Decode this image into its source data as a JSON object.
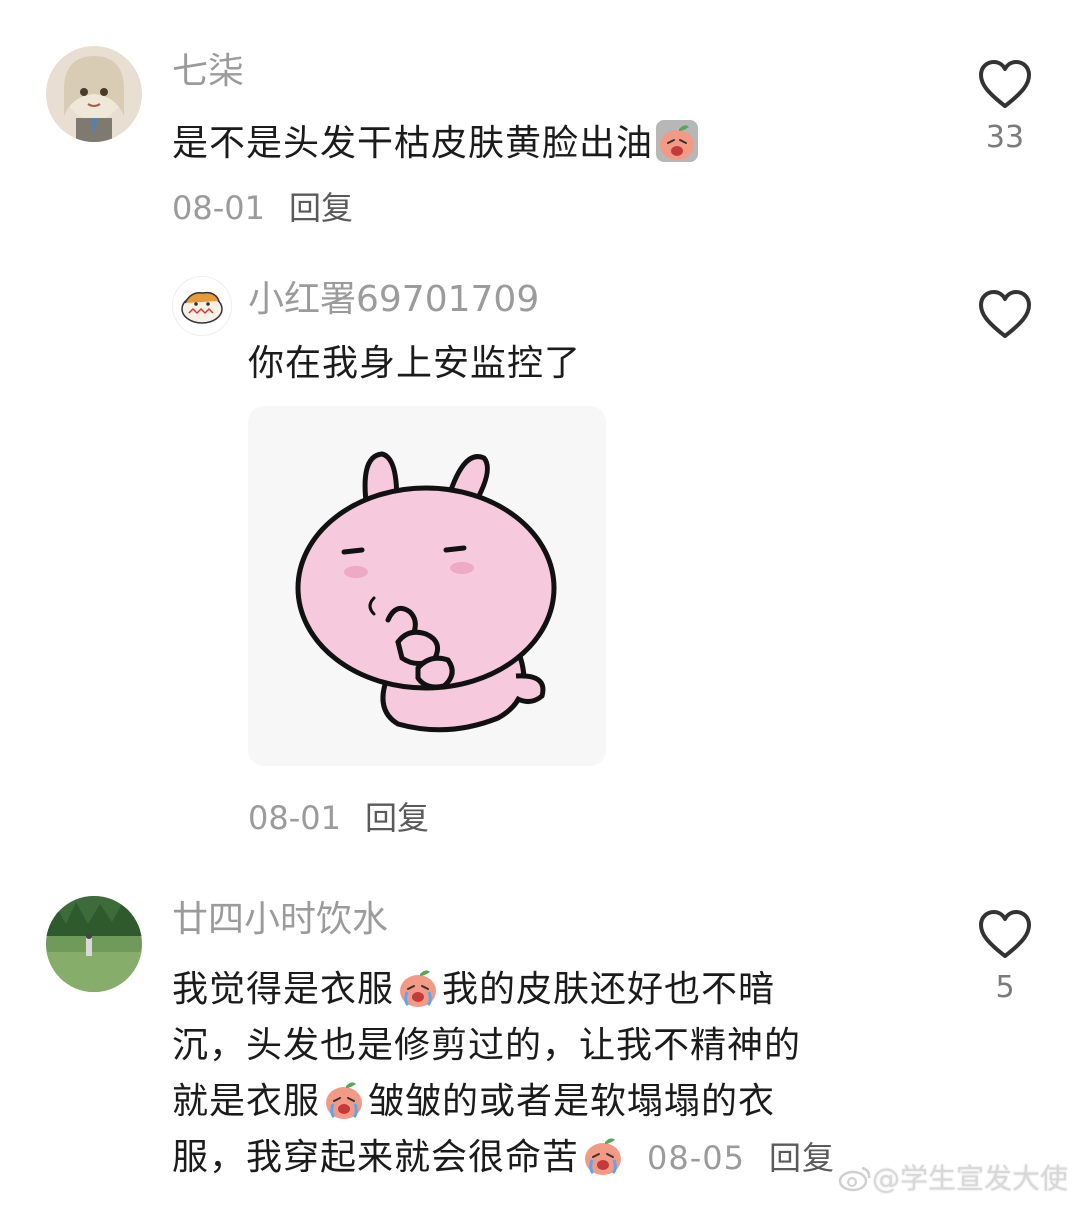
{
  "comments": [
    {
      "username": "七柒",
      "text_a": "是不是头发干枯皮肤黄脸出油",
      "date": "08-01",
      "reply_label": "回复",
      "like_count": "33"
    },
    {
      "username": "小红署69701709",
      "text_a": "你在我身上安监控了",
      "date": "08-01",
      "reply_label": "回复",
      "like_count": ""
    },
    {
      "username": "廿四小时饮水",
      "line1_a": "我觉得是衣服",
      "line1_b": "我的皮肤还好也不暗",
      "line2": "沉，头发也是修剪过的，让我不精神的",
      "line3_a": "就是衣服",
      "line3_b": "皱皱的或者是软塌塌的衣",
      "line4_a": "服，我穿起来就会很命苦",
      "date": "08-05",
      "reply_label": "回复",
      "like_count": "5"
    }
  ],
  "watermark": "@学生宣发大使",
  "colors": {
    "username": "#9b9b9b",
    "text": "#1b1b1b",
    "sticker_bg": "#f7f7f7",
    "bunny_pink": "#f6c9dd"
  },
  "icons": {
    "like": "heart-outline-icon",
    "emoji": "crying-peach-emoji-icon",
    "watermark": "weibo-logo-icon"
  }
}
